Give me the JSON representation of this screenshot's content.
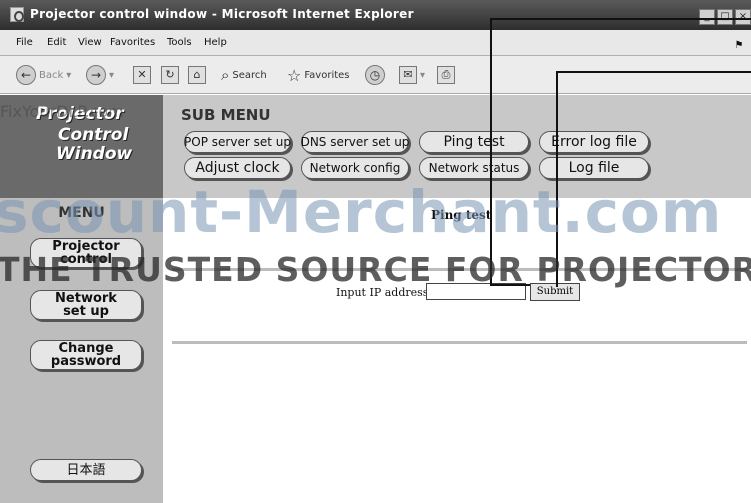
{
  "window": {
    "title": "Projector control window - Microsoft Internet Explorer",
    "buttons": [
      "_",
      "□",
      "×"
    ]
  },
  "menubar": {
    "items": [
      "File",
      "Edit",
      "View",
      "Favorites",
      "Tools",
      "Help"
    ]
  },
  "toolbar": {
    "back": "Back",
    "search": "Search",
    "favorites": "Favorites"
  },
  "logo": {
    "lines": [
      "Projector",
      "Control",
      "Window"
    ]
  },
  "sidebar": {
    "menu_title": "MENU",
    "items": [
      {
        "line1": "Projector",
        "line2": "control"
      },
      {
        "line1": "Network",
        "line2": "set up"
      },
      {
        "line1": "Change",
        "line2": "password"
      }
    ],
    "language_button": "日本語"
  },
  "submenu": {
    "title": "SUB MENU",
    "row1": [
      "POP server set up",
      "DNS server set up",
      "Ping test",
      "Error log file"
    ],
    "row2": [
      "Adjust clock",
      "Network config",
      "Network status",
      "Log file"
    ]
  },
  "page": {
    "heading": "Ping test",
    "ip_label": "Input IP address",
    "ip_value": "",
    "submit_label": "Submit"
  },
  "watermarks": {
    "small": "FixYourDLP.com",
    "brand": "scount-Merchant.com",
    "tagline": "THE TRUSTED SOURCE FOR PROJECTOR LAMPS"
  },
  "colors": {
    "titlebar": "#3a3a3a",
    "sidebar": "#bdbdbd",
    "logo_bg": "#6a6a6a",
    "watermark_blue": "#7896b4"
  }
}
